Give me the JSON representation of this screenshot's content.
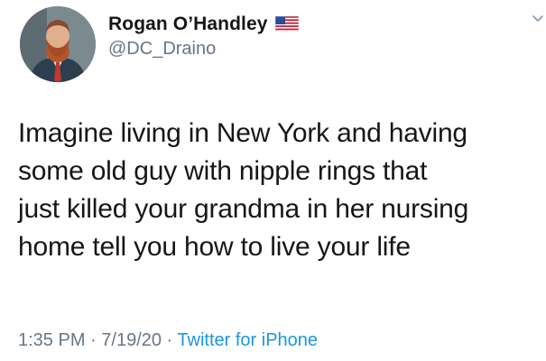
{
  "user": {
    "display_name": "Rogan O’Handley",
    "handle": "@DC_Draino",
    "badge_icon": "us-flag-icon"
  },
  "tweet": {
    "text": "Imagine living in New York and having\nsome old guy with nipple rings that\njust killed your grandma in her nursing\nhome tell you how to live your life"
  },
  "meta": {
    "time": "1:35 PM",
    "separator_1": " · ",
    "date": "7/19/20",
    "separator_2": " · ",
    "source": "Twitter for iPhone"
  },
  "colors": {
    "text": "#14171a",
    "secondary": "#657786",
    "link": "#1b95e0"
  }
}
